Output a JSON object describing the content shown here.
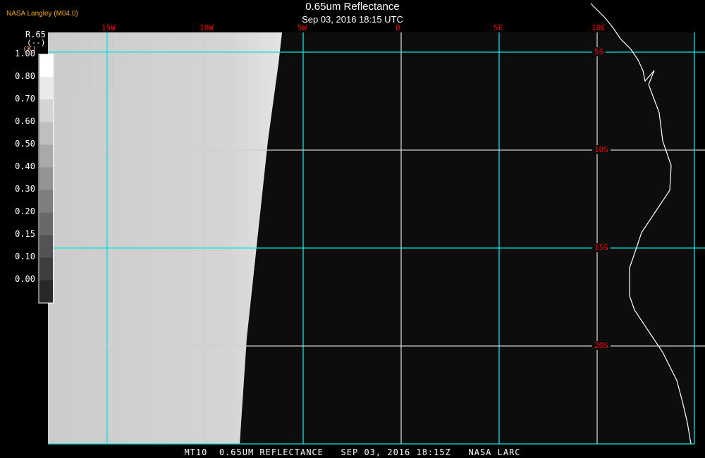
{
  "header": {
    "org": "NASA Langley (M04.0)",
    "title": "0.65um Reflectance",
    "subtitle": "Sep 03, 2016 18:15 UTC"
  },
  "colorbar": {
    "variable": "R.65",
    "units": "(--)",
    "extra": "(K)",
    "ticks": [
      "1.00",
      "0.80",
      "0.70",
      "0.60",
      "0.50",
      "0.40",
      "0.30",
      "0.20",
      "0.15",
      "0.10",
      "0.00"
    ]
  },
  "map": {
    "lon_labels": [
      "15W",
      "10W",
      "5W",
      "0",
      "5E",
      "10E"
    ],
    "lat_labels": [
      "5S",
      "10S",
      "15S",
      "20S"
    ],
    "grid_color": "#00e5e5",
    "label_color": "#ff0000",
    "coast_color": "#ffffff"
  },
  "footer": "MT10  0.65UM REFLECTANCE   SEP 03, 2016 18:15Z   NASA LARC"
}
